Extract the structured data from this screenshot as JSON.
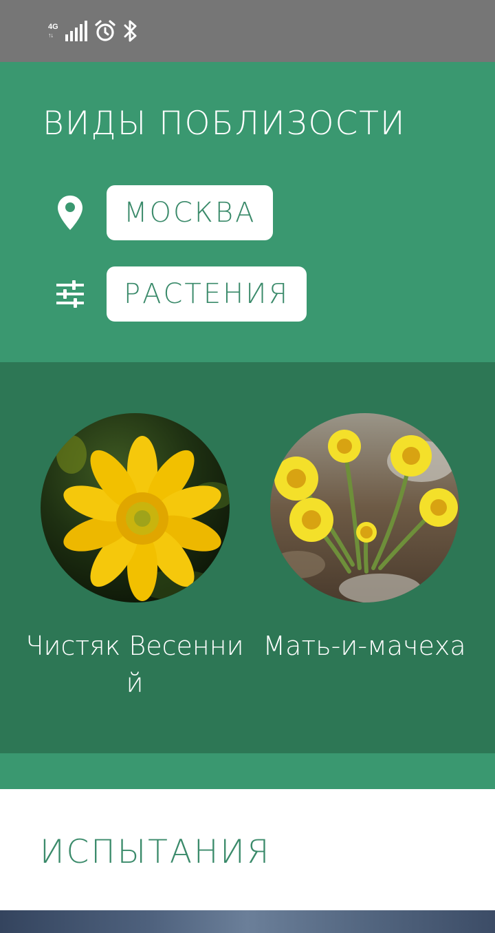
{
  "status_bar": {
    "network": "4G",
    "icons": [
      "network-type-icon",
      "signal-icon",
      "alarm-icon",
      "bluetooth-icon"
    ]
  },
  "nearby": {
    "title": "ВИДЫ ПОБЛИЗОСТИ",
    "location": {
      "icon": "location-pin-icon",
      "value": "МОСКВА"
    },
    "category": {
      "icon": "filter-sliders-icon",
      "value": "РАСТЕНИЯ"
    }
  },
  "species": [
    {
      "name": "Чистяк Весенний",
      "image": "lesser-celandine-photo"
    },
    {
      "name": "Мать-и-мачеха",
      "image": "coltsfoot-photo"
    }
  ],
  "trials": {
    "title": "ИСПЫТАНИЯ"
  },
  "colors": {
    "header_green": "#3a9870",
    "species_green": "#2d7755",
    "text_green": "#3a8a6a",
    "status_bar_gray": "#767676"
  }
}
